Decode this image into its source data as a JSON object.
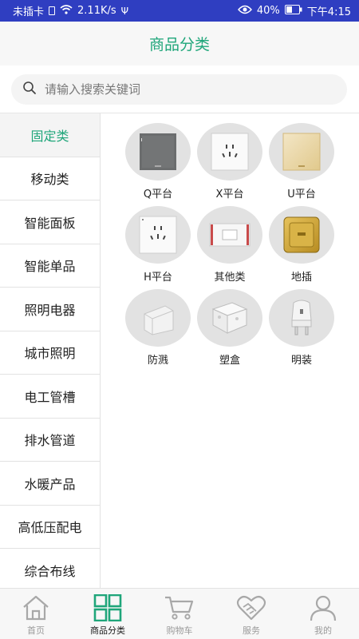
{
  "status_bar": {
    "carrier": "未插卡",
    "speed": "2.11K/s",
    "battery": "40%",
    "time": "下午4:15"
  },
  "header": {
    "title": "商品分类"
  },
  "search": {
    "placeholder": "请输入搜索关键词"
  },
  "sidebar": {
    "items": [
      {
        "label": "固定类",
        "active": true
      },
      {
        "label": "移动类"
      },
      {
        "label": "智能面板"
      },
      {
        "label": "智能单品"
      },
      {
        "label": "照明电器"
      },
      {
        "label": "城市照明"
      },
      {
        "label": "电工管槽"
      },
      {
        "label": "排水管道"
      },
      {
        "label": "水暖产品"
      },
      {
        "label": "高低压配电"
      },
      {
        "label": "综合布线"
      }
    ]
  },
  "grid": {
    "items": [
      {
        "label": "Q平台",
        "icon": "gray-switch-panel-icon"
      },
      {
        "label": "X平台",
        "icon": "white-socket-panel-icon"
      },
      {
        "label": "U平台",
        "icon": "gold-panel-icon"
      },
      {
        "label": "H平台",
        "icon": "socket-panel-icon"
      },
      {
        "label": "其他类",
        "icon": "rocker-switch-icon"
      },
      {
        "label": "地插",
        "icon": "floor-socket-icon"
      },
      {
        "label": "防溅",
        "icon": "splash-cover-icon"
      },
      {
        "label": "塑盒",
        "icon": "plastic-box-icon"
      },
      {
        "label": "明装",
        "icon": "surface-mount-socket-icon"
      }
    ]
  },
  "tabbar": {
    "items": [
      {
        "label": "首页",
        "icon": "home-icon"
      },
      {
        "label": "商品分类",
        "icon": "category-grid-icon",
        "active": true
      },
      {
        "label": "购物车",
        "icon": "cart-icon"
      },
      {
        "label": "服务",
        "icon": "handshake-heart-icon"
      },
      {
        "label": "我的",
        "icon": "user-icon"
      }
    ]
  },
  "colors": {
    "accent": "#1fa67a",
    "status_bar": "#2f3ec1",
    "tab_inactive": "#9a9a9a"
  }
}
